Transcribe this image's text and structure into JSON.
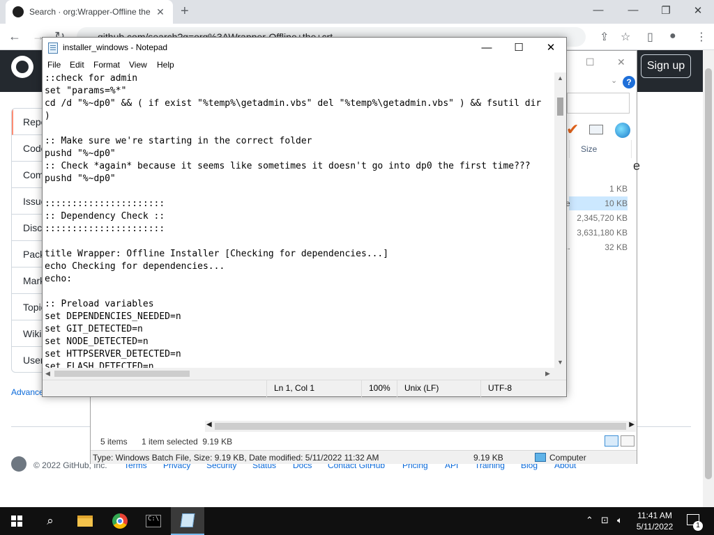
{
  "browser": {
    "tab_title": "Search · org:Wrapper-Offline the",
    "tab_close": "✕",
    "new_tab": "+",
    "url": "github.com/search?q=org%3AWrapper-Offline+the+crt",
    "window_controls": {
      "minimize": "—",
      "restore": "❐",
      "close": "✕"
    },
    "nav": {
      "back": "←",
      "forward": "→",
      "reload": "↻"
    }
  },
  "github": {
    "signup_label": "Sign up",
    "sidebar_items": [
      "Repositories",
      "Code",
      "Commits",
      "Issues",
      "Discussions",
      "Packages",
      "Marketplace",
      "Topics",
      "Wikis",
      "Users"
    ],
    "advanced_label": "Advanced search",
    "footer": {
      "copyright": "© 2022 GitHub, Inc.",
      "links": [
        "Terms",
        "Privacy",
        "Security",
        "Status",
        "Docs",
        "Contact GitHub",
        "Pricing",
        "API",
        "Training",
        "Blog",
        "About"
      ]
    }
  },
  "explorer": {
    "column_size": "Size",
    "heading_fragment": "e",
    "row_fragment_selected": "e",
    "row_fragment_other": "..",
    "sizes": [
      "1 KB",
      "10 KB",
      "2,345,720 KB",
      "3,631,180 KB",
      "32 KB"
    ],
    "selected_row": 1,
    "status_items": "5 items",
    "status_selected": "1 item selected  9.19 KB",
    "details_text": "Type: Windows Batch File, Size: 9.19 KB, Date modified: 5/11/2022 11:32 AM",
    "details_size": "9.19 KB",
    "details_location": "Computer",
    "help_label": "?"
  },
  "notepad": {
    "title": "installer_windows - Notepad",
    "controls": {
      "minimize": "—",
      "maximize": "☐",
      "close": "✕"
    },
    "menu": [
      "File",
      "Edit",
      "Format",
      "View",
      "Help"
    ],
    "lines": [
      "::check for admin",
      "set \"params=%*\"",
      "cd /d \"%~dp0\" && ( if exist \"%temp%\\getadmin.vbs\" del \"%temp%\\getadmin.vbs\" ) && fsutil dir",
      ")",
      "",
      ":: Make sure we're starting in the correct folder",
      "pushd \"%~dp0\"",
      ":: Check *again* because it seems like sometimes it doesn't go into dp0 the first time???",
      "pushd \"%~dp0\"",
      "",
      "::::::::::::::::::::::",
      ":: Dependency Check ::",
      "::::::::::::::::::::::",
      "",
      "title Wrapper: Offline Installer [Checking for dependencies...]",
      "echo Checking for dependencies...",
      "echo:",
      "",
      ":: Preload variables",
      "set DEPENDENCIES_NEEDED=n",
      "set GIT_DETECTED=n",
      "set NODE_DETECTED=n",
      "set HTTPSERVER_DETECTED=n",
      "set FLASH_DETECTED=n"
    ],
    "status": {
      "position": "Ln 1, Col 1",
      "zoom": "100%",
      "line_ending": "Unix (LF)",
      "encoding": "UTF-8"
    }
  },
  "taskbar": {
    "time": "11:41 AM",
    "date": "5/11/2022",
    "notification_count": "1"
  }
}
